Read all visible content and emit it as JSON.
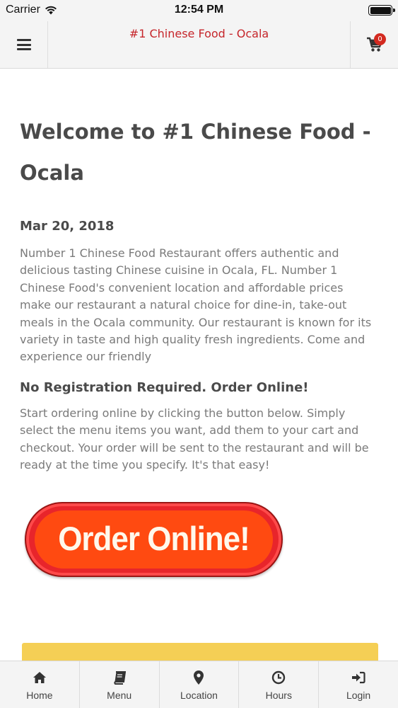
{
  "status_bar": {
    "carrier": "Carrier",
    "time": "12:54 PM"
  },
  "header": {
    "title": "#1 Chinese Food - Ocala",
    "cart_count": "0"
  },
  "main": {
    "welcome_title": "Welcome to #1 Chinese Food - Ocala",
    "date": "Mar 20, 2018",
    "intro": "Number 1 Chinese Food Restaurant offers authentic and delicious tasting Chinese cuisine in Ocala, FL.  Number 1 Chinese Food's convenient location and affordable prices make our restaurant a natural choice for dine-in, take-out meals in the Ocala community. Our restaurant is known for its variety in taste and high quality fresh ingredients. Come and experience our friendly",
    "section_heading": "No Registration Required. Order Online!",
    "ordering_text": "Start ordering online by clicking the button below. Simply select the menu items you want, add them to your cart and checkout. Your order will be sent to the restaurant and will be ready at the time you specify. It's that easy!",
    "order_button_label": "Order Online!"
  },
  "bottom_nav": {
    "items": [
      {
        "label": "Home",
        "icon": "home-icon"
      },
      {
        "label": "Menu",
        "icon": "book-icon"
      },
      {
        "label": "Location",
        "icon": "map-pin-icon"
      },
      {
        "label": "Hours",
        "icon": "clock-icon"
      },
      {
        "label": "Login",
        "icon": "sign-in-icon"
      }
    ]
  },
  "colors": {
    "brand_red": "#c6262b",
    "button_red": "#e8252b",
    "promo_yellow": "#f5cf55"
  }
}
